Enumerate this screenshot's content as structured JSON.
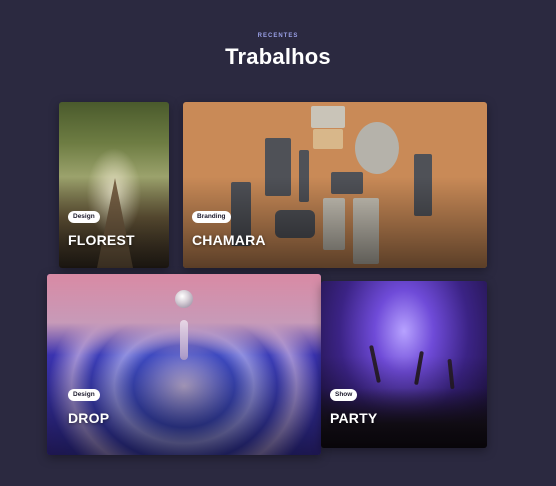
{
  "section": {
    "eyebrow": "RECENTES",
    "title": "Trabalhos"
  },
  "cards": [
    {
      "id": "florest",
      "badge": "Design",
      "title": "FLOREST"
    },
    {
      "id": "chamara",
      "badge": "Branding",
      "title": "CHAMARA"
    },
    {
      "id": "drop",
      "badge": "Design",
      "title": "DROP"
    },
    {
      "id": "party",
      "badge": "Show",
      "title": "PARTY"
    }
  ],
  "colors": {
    "background": "#2b2940",
    "eyebrow": "#9aa0e6",
    "badge_bg": "#ffffff"
  }
}
